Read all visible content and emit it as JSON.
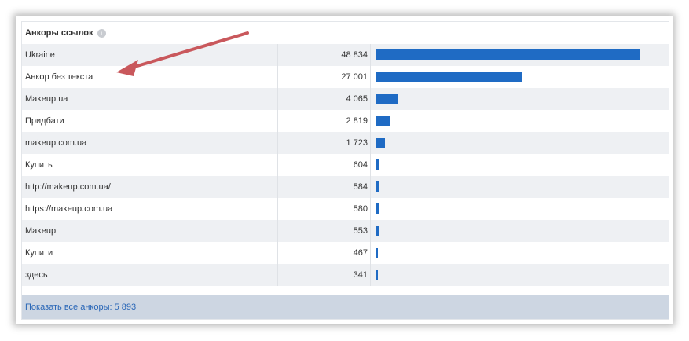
{
  "widget": {
    "title": "Анкоры ссылок",
    "info_icon": "i"
  },
  "rows": [
    {
      "label": "Ukraine",
      "count": "48 834",
      "value": 48834
    },
    {
      "label": "Анкор без текста",
      "count": "27 001",
      "value": 27001
    },
    {
      "label": "Makeup.ua",
      "count": "4 065",
      "value": 4065
    },
    {
      "label": "Придбати",
      "count": "2 819",
      "value": 2819
    },
    {
      "label": "makeup.com.ua",
      "count": "1 723",
      "value": 1723
    },
    {
      "label": "Купить",
      "count": "604",
      "value": 604
    },
    {
      "label": "http://makeup.com.ua/",
      "count": "584",
      "value": 584
    },
    {
      "label": "https://makeup.com.ua",
      "count": "580",
      "value": 580
    },
    {
      "label": "Makeup",
      "count": "553",
      "value": 553
    },
    {
      "label": "Купити",
      "count": "467",
      "value": 467
    },
    {
      "label": "здесь",
      "count": "341",
      "value": 341
    }
  ],
  "footer": {
    "show_all_label": "Показать все анкоры: 5 893"
  },
  "colors": {
    "bar": "#1f6bc4",
    "arrow": "#c9585c",
    "link": "#2a67b7"
  },
  "icons": {
    "info": "info-icon",
    "annotation": "annotation-arrow"
  }
}
